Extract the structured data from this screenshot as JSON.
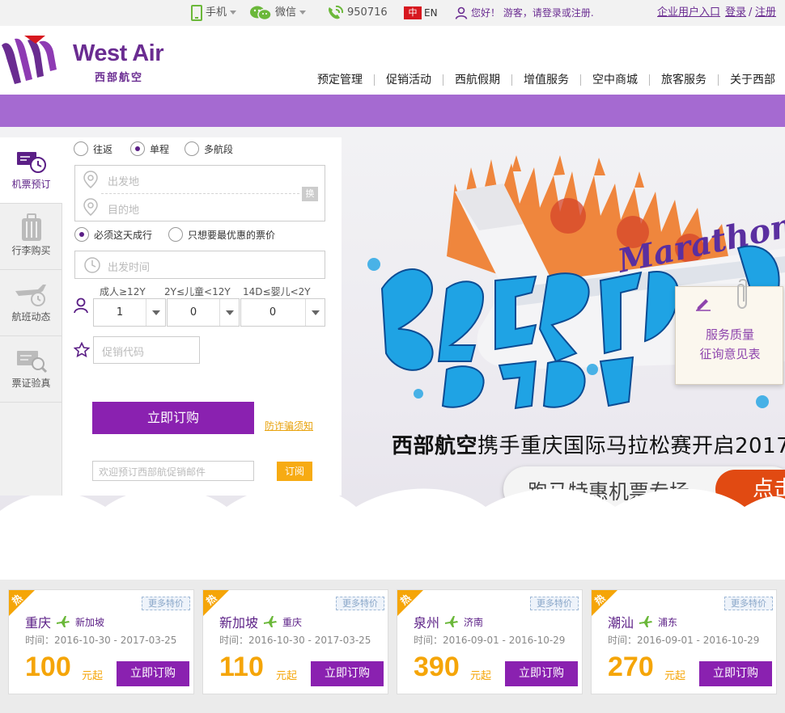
{
  "topbar": {
    "mobile": "手机",
    "wechat": "微信",
    "hotline": "950716",
    "lang_zh": "中",
    "lang_en": "EN",
    "greeting": "您好！ 游客，请登录或注册.",
    "enterprise": "企业用户入口",
    "login": "登录",
    "slash": "/",
    "register": "注册"
  },
  "brand": {
    "name_en": "West Air",
    "name_cn": "西部航空",
    "color": "#6a2c91"
  },
  "nav": [
    "预定管理",
    "促销活动",
    "西航假期",
    "增值服务",
    "空中商城",
    "旅客服务",
    "关于西部"
  ],
  "side_tabs": [
    {
      "label": "机票预订",
      "icon": "ticket-clock-icon",
      "active": true
    },
    {
      "label": "行李购买",
      "icon": "luggage-icon",
      "active": false
    },
    {
      "label": "航班动态",
      "icon": "plane-clock-icon",
      "active": false
    },
    {
      "label": "票证验真",
      "icon": "ticket-search-icon",
      "active": false
    }
  ],
  "booking": {
    "trip_types": [
      "往返",
      "单程",
      "多航段"
    ],
    "selected_trip": "单程",
    "origin_placeholder": "出发地",
    "destination_placeholder": "目的地",
    "swap": "换",
    "date_options": [
      "必须这天成行",
      "只想要最优惠的票价"
    ],
    "date_placeholder": "出发时间",
    "passengers": [
      {
        "label": "成人≥12Y",
        "value": "1"
      },
      {
        "label": "2Y≤儿童<12Y",
        "value": "0"
      },
      {
        "label": "14D≤婴儿<2Y",
        "value": "0"
      }
    ],
    "promo_placeholder": "促销代码",
    "submit": "立即订购",
    "fraud_notice": "防诈骗须知",
    "email_placeholder": "欢迎预订西部航促销邮件",
    "subscribe": "订阅"
  },
  "hero": {
    "caption_bold": "西部航空",
    "caption_rest": "携手重庆国际马拉松赛开启2017",
    "promo": "跑马特惠机票专场",
    "cta": "点击",
    "slides": 5,
    "active_slide": 0,
    "survey_line1": "服务质量",
    "survey_line2": "征询意见表"
  },
  "deals": [
    {
      "from": "重庆",
      "to": "新加坡",
      "dates": "时间：2016-10-30 - 2017-03-25",
      "price": "100"
    },
    {
      "from": "新加坡",
      "to": "重庆",
      "dates": "时间：2016-10-30 - 2017-03-25",
      "price": "110"
    },
    {
      "from": "泉州",
      "to": "济南",
      "dates": "时间：2016-09-01 - 2016-10-29",
      "price": "390"
    },
    {
      "from": "潮汕",
      "to": "浦东",
      "dates": "时间：2016-09-01 - 2016-10-29",
      "price": "270"
    }
  ],
  "deal_labels": {
    "hot": "热",
    "more": "更多特价",
    "unit": "元起",
    "buy": "立即订购"
  },
  "colors": {
    "purple": "#8a21b0",
    "band": "#a56ad1",
    "price": "#f5a507",
    "green": "#6bb83a"
  }
}
